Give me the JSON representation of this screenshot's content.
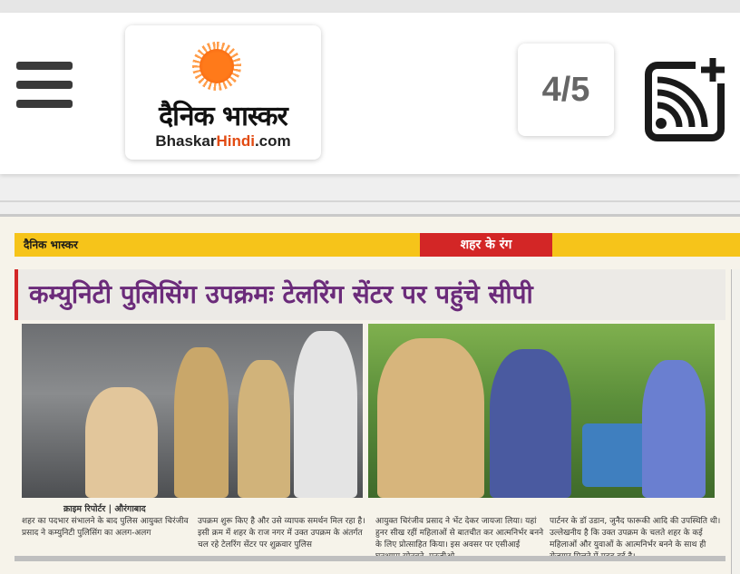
{
  "header": {
    "menu_icon": "hamburger-menu-icon",
    "logo": {
      "name": "दैनिक भास्कर",
      "sub_prefix": "Bhaskar",
      "sub_highlight": "Hindi",
      "sub_suffix": ".com"
    },
    "page_counter": "4/5",
    "feed_icon": "rss-add-icon"
  },
  "paper": {
    "band_brand": "दैनिक भास्कर",
    "band_section": "शहर के रंग",
    "headline": "कम्युनिटी पुलिसिंग उपक्रमः टेलरिंग सेंटर पर पहुंचे सीपी",
    "reporter": "क्राइम रिपोर्टर | औरंगाबाद",
    "columns": [
      "शहर का पदभार संभालने के बाद पुलिस आयुक्त चिरंजीव प्रसाद ने कम्युनिटी पुलिसिंग का अलग-अलग",
      "उपक्रम शुरू किए है और उसे व्यापक समर्थन मिल रहा है। इसी क्रम में शहर के राज नगर में उक्त उपक्रम के अंतर्गत चल रहे टेलरिंग सेंटर पर शुक्रवार पुलिस",
      "आयुक्त चिरंजीव प्रसाद ने भेंट देकर जायजा लिया। यहां हुनर सीख रहीं महिलाओं से बातचीत कर आत्मनिर्भर बनने के लिए प्रोत्साहित किया। इस अवसर पर एसीआई घनश्याम सोनवने, एनजीओ",
      "पार्टनर के डॉ उडान, जुनैद फारूकी आदि की उपस्थिति थी। उल्लेखनीय है कि उक्त उपक्रम के चलते शहर के कई महिलाओं और युवाओं के आत्मनिर्भर बनने के साथ ही रोजगार मिलने में मदद हुई है।"
    ]
  },
  "colors": {
    "band_yellow": "#f6c41a",
    "section_red": "#d32626",
    "headline_purple": "#6b2b7a",
    "logo_orange": "#e24b12"
  }
}
